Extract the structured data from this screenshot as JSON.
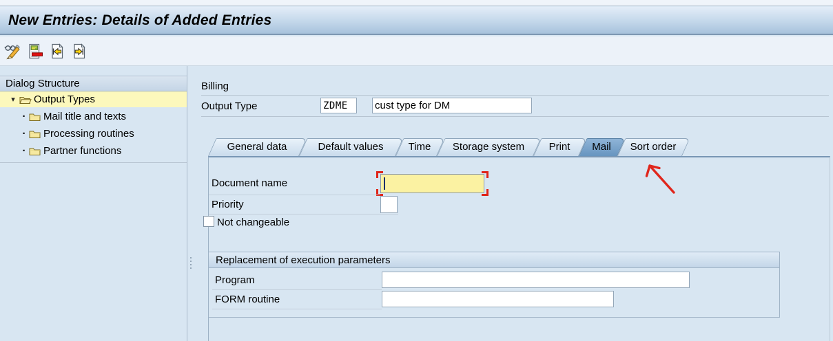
{
  "window": {
    "title": "New Entries: Details of Added Entries"
  },
  "toolbar": {
    "buttons": [
      {
        "icon": "display-change-icon"
      },
      {
        "icon": "delete-entry-icon"
      },
      {
        "icon": "previous-entry-icon"
      },
      {
        "icon": "next-entry-icon"
      }
    ]
  },
  "dialog_structure": {
    "header": "Dialog Structure",
    "items": [
      {
        "label": "Output Types",
        "selected": true,
        "expanded": true,
        "icon": "open-folder-icon"
      },
      {
        "label": "Mail title and texts",
        "icon": "folder-icon"
      },
      {
        "label": "Processing routines",
        "icon": "folder-icon"
      },
      {
        "label": "Partner functions",
        "icon": "folder-icon"
      }
    ]
  },
  "detail": {
    "section_label": "Billing",
    "output_type": {
      "label": "Output Type",
      "code": "ZDME",
      "description": "cust type for DM"
    },
    "tabs": {
      "active": "Mail",
      "items": [
        {
          "label": "General data"
        },
        {
          "label": "Default values"
        },
        {
          "label": "Time"
        },
        {
          "label": "Storage system"
        },
        {
          "label": "Print"
        },
        {
          "label": "Mail"
        },
        {
          "label": "Sort order"
        }
      ]
    },
    "mail_tab": {
      "document_name": {
        "label": "Document name",
        "value": "",
        "focused": true
      },
      "priority": {
        "label": "Priority",
        "value": ""
      },
      "not_changeable": {
        "label": "Not changeable",
        "checked": false
      },
      "replacement_group": {
        "title": "Replacement of execution parameters",
        "program": {
          "label": "Program",
          "value": ""
        },
        "form_routine": {
          "label": "FORM routine",
          "value": ""
        }
      }
    }
  },
  "annotation": {
    "type": "arrow",
    "color": "#e02417",
    "target": "Sort order tab"
  },
  "colors": {
    "selected_tree_row": "#fcf8bc",
    "focused_field_bg": "#fbf2a2",
    "focus_bracket": "#e02417",
    "active_tab": "#6d9ac4",
    "titlebar_gradient_bottom": "#a7c2dc"
  }
}
